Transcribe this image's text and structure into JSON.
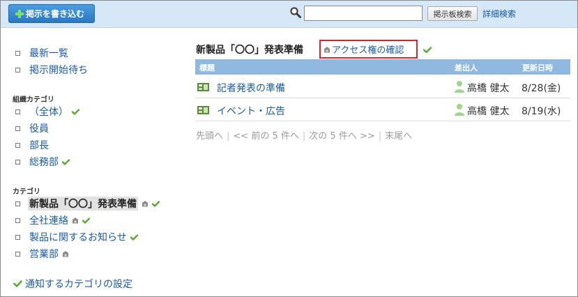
{
  "toolbar": {
    "post_label": "掲示を書き込む",
    "search_value": "",
    "search_button": "掲示板検索",
    "advanced_search": "詳細検索"
  },
  "sidebar": {
    "top_items": [
      {
        "label": "最新一覧"
      },
      {
        "label": "掲示開始待ち"
      }
    ],
    "org_heading": "組織カテゴリ",
    "org_items": [
      {
        "label": "（全体）"
      },
      {
        "label": "役員"
      },
      {
        "label": "部長"
      },
      {
        "label": "総務部"
      }
    ],
    "cat_heading": "カテゴリ",
    "cat_items": [
      {
        "label": "新製品「〇〇」発表準備"
      },
      {
        "label": "全社連絡"
      },
      {
        "label": "製品に関するお知らせ"
      },
      {
        "label": "営業部"
      }
    ],
    "notify_link": "通知するカテゴリの設定"
  },
  "main": {
    "title": "新製品「〇〇」発表準備",
    "access_link": "アクセス権の確認",
    "columns": {
      "title": "標題",
      "sender": "差出人",
      "updated": "更新日時"
    },
    "rows": [
      {
        "title": "記者発表の準備",
        "sender": "高橋 健太",
        "date": "8/28(金)"
      },
      {
        "title": "イベント・広告",
        "sender": "高橋 健太",
        "date": "8/19(水)"
      }
    ],
    "pager": {
      "first": "先頭へ",
      "prev": "<< 前の 5 件へ",
      "next": "次の 5 件へ >>",
      "last": "末尾へ"
    }
  },
  "colors": {
    "header_bg": "#d6e8f7",
    "primary_button": "#2f82cb",
    "link": "#1a5aa6",
    "table_header": "#8fb9de",
    "highlight_border": "#d9252a",
    "check": "#5aa832"
  }
}
